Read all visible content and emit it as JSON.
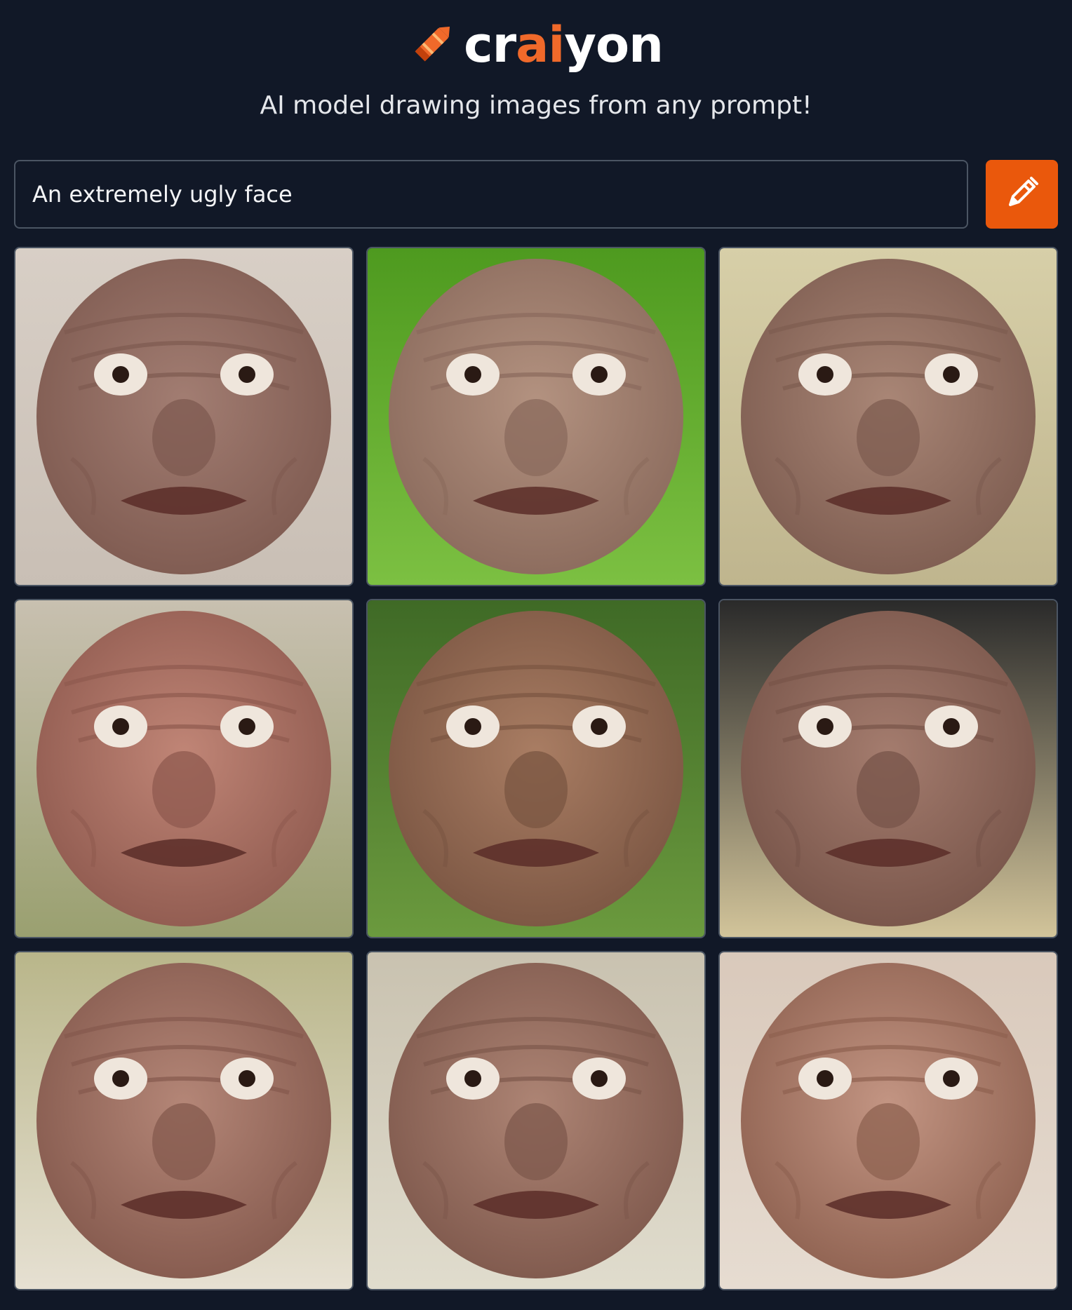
{
  "header": {
    "logo_parts": [
      "cr",
      "ai",
      "yon"
    ],
    "tagline": "AI model drawing images from any prompt!",
    "accent_color": "#f0692a"
  },
  "search": {
    "value": "An extremely ugly face",
    "button_icon": "pencil-icon",
    "button_color": "#ea580c"
  },
  "results": [
    {
      "bg": "#d8cfc6",
      "bg2": "#c9bfb5",
      "skin": "#a27d72",
      "skin_dark": "#7e5a50"
    },
    {
      "bg": "#4e9a1f",
      "bg2": "#7cc042",
      "skin": "#b39280",
      "skin_dark": "#8a6a5c"
    },
    {
      "bg": "#d7cfa8",
      "bg2": "#bfb58e",
      "skin": "#a98676",
      "skin_dark": "#7d5c50"
    },
    {
      "bg": "#c8c0b0",
      "bg2": "#9aa070",
      "skin": "#c08576",
      "skin_dark": "#8f5a4f"
    },
    {
      "bg": "#3f6a26",
      "bg2": "#6b9a3e",
      "skin": "#a97d63",
      "skin_dark": "#7a5542"
    },
    {
      "bg": "#2a2a2a",
      "bg2": "#d2c49a",
      "skin": "#a47c6e",
      "skin_dark": "#775449"
    },
    {
      "bg": "#b9b68a",
      "bg2": "#e6e0d2",
      "skin": "#b48677",
      "skin_dark": "#84594d"
    },
    {
      "bg": "#c9c2b0",
      "bg2": "#e0dccd",
      "skin": "#ad8474",
      "skin_dark": "#7e584c"
    },
    {
      "bg": "#d9c9bb",
      "bg2": "#e6dcd1",
      "skin": "#c39583",
      "skin_dark": "#8e6150"
    }
  ]
}
